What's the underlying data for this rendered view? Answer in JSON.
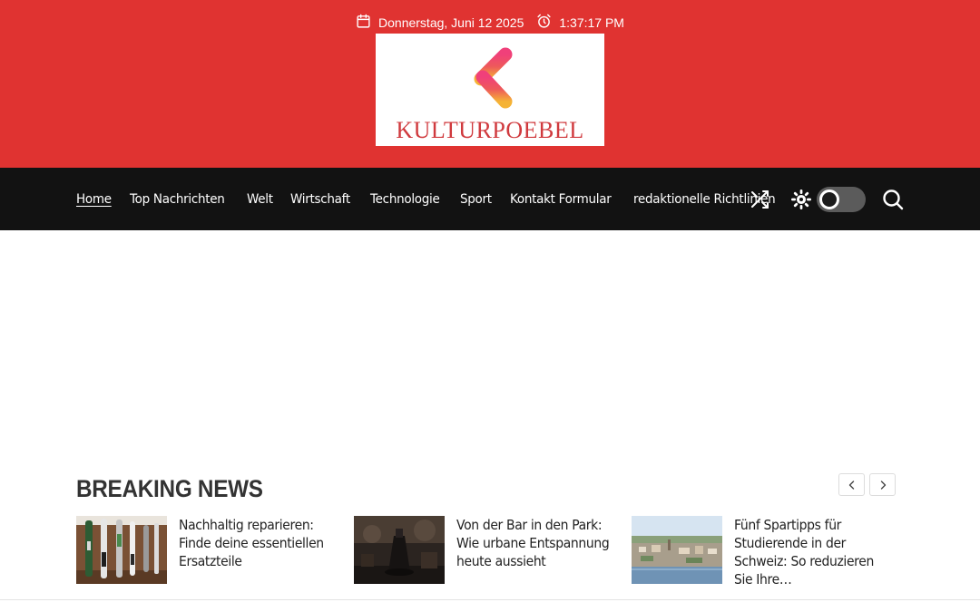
{
  "header": {
    "date": "Donnerstag, Juni 12 2025",
    "time": "1:37:17 PM",
    "logo_text": "KULTURPOEBEL",
    "bg_color": "#e03331"
  },
  "nav": {
    "items": [
      {
        "label": "Home",
        "active": true
      },
      {
        "label": "Top Nachrichten"
      },
      {
        "label": "Welt"
      },
      {
        "label": "Wirtschaft"
      },
      {
        "label": "Technologie"
      },
      {
        "label": "Sport"
      },
      {
        "label": "Kontakt Formular"
      },
      {
        "label": "redaktionelle Richtlinien"
      }
    ],
    "icons": [
      "shuffle-icon",
      "sun-icon",
      "dark-mode-toggle",
      "search-icon"
    ]
  },
  "breaking": {
    "title": "BREAKING NEWS",
    "items": [
      {
        "title": "Nachhaltig reparieren: Finde deine essentiellen Ersatzteile"
      },
      {
        "title": "Von der Bar in den Park: Wie urbane Entspannung heute aussieht"
      },
      {
        "title": "Fünf Spartipps für Studierende in der Schweiz: So reduzieren Sie Ihre…"
      }
    ]
  }
}
